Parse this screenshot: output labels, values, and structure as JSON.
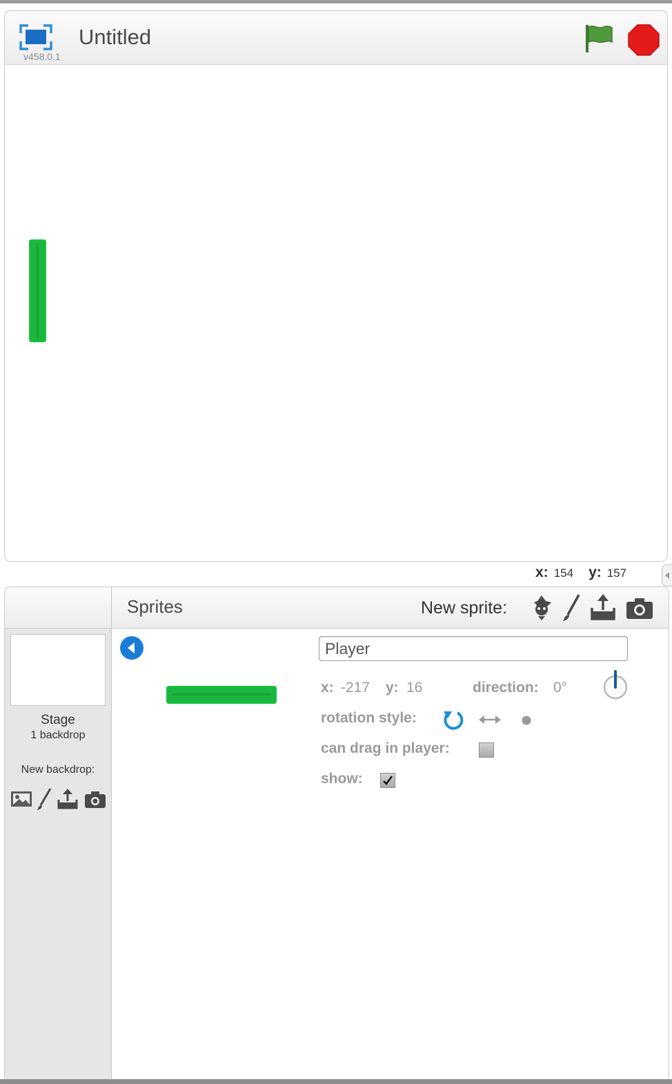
{
  "stage": {
    "title": "Untitled",
    "version": "v458.0.1"
  },
  "mouse": {
    "x_label": "x:",
    "x_value": "154",
    "y_label": "y:",
    "y_value": "157"
  },
  "stage_column": {
    "label": "Stage",
    "backdrop_count": "1 backdrop",
    "new_backdrop_label": "New backdrop:",
    "backdrop_tools": [
      "image-library-icon",
      "paint-brush-icon",
      "upload-icon",
      "camera-icon"
    ]
  },
  "sprites_panel": {
    "title": "Sprites",
    "new_sprite_label": "New sprite:",
    "new_sprite_tools": [
      "sprite-library-icon",
      "paint-brush-icon",
      "upload-icon",
      "camera-icon"
    ]
  },
  "sprite_info": {
    "name_value": "Player",
    "x_label": "x:",
    "x_value": "-217",
    "y_label": "y:",
    "y_value": "16",
    "direction_label": "direction:",
    "direction_value": "0°",
    "rotation_style_label": "rotation style:",
    "can_drag_label": "can drag in player:",
    "can_drag_checked": false,
    "show_label": "show:",
    "show_checked": true
  },
  "colors": {
    "sprite_green": "#1cb640",
    "flag_green": "#4a8b36",
    "stop_red": "#e41a1a",
    "accent_blue": "#1a7cd6"
  }
}
